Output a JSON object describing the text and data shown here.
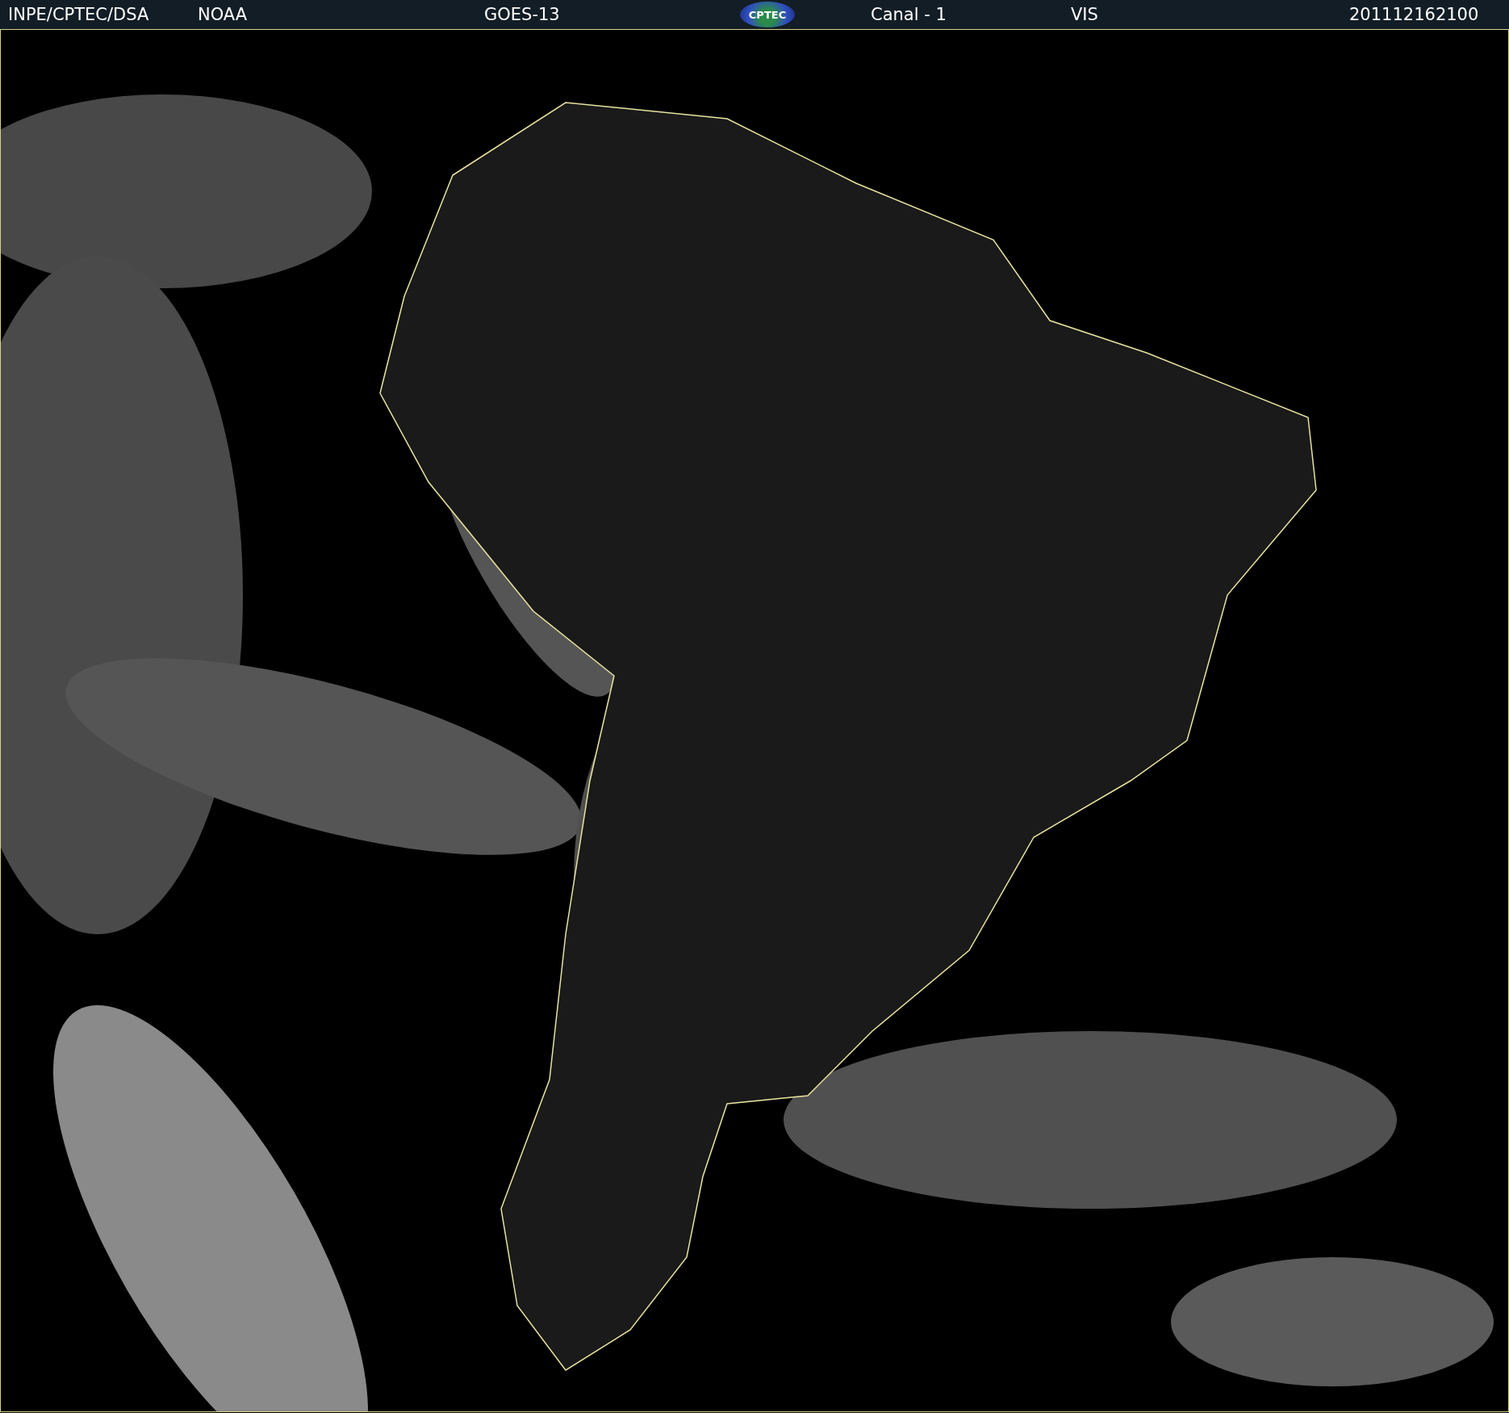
{
  "header": {
    "source": "INPE/CPTEC/DSA",
    "agency": "NOAA",
    "satellite": "GOES-13",
    "logo": "CPTEC",
    "channel": "Canal - 1",
    "band": "VIS",
    "timestamp": "201112162100"
  }
}
